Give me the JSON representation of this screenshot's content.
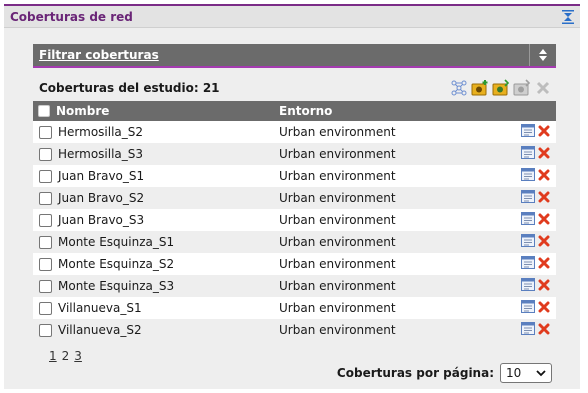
{
  "panel": {
    "title": "Coberturas de red"
  },
  "filter": {
    "label": "Filtrar coberturas"
  },
  "study": {
    "count_label": "Coberturas del estudio: 21"
  },
  "table": {
    "headers": {
      "name": "Nombre",
      "environment": "Entorno"
    },
    "rows": [
      {
        "name": "Hermosilla_S2",
        "environment": "Urban environment"
      },
      {
        "name": "Hermosilla_S3",
        "environment": "Urban environment"
      },
      {
        "name": "Juan Bravo_S1",
        "environment": "Urban environment"
      },
      {
        "name": "Juan Bravo_S2",
        "environment": "Urban environment"
      },
      {
        "name": "Juan Bravo_S3",
        "environment": "Urban environment"
      },
      {
        "name": "Monte Esquinza_S1",
        "environment": "Urban environment"
      },
      {
        "name": "Monte Esquinza_S2",
        "environment": "Urban environment"
      },
      {
        "name": "Monte Esquinza_S3",
        "environment": "Urban environment"
      },
      {
        "name": "Villanueva_S1",
        "environment": "Urban environment"
      },
      {
        "name": "Villanueva_S2",
        "environment": "Urban environment"
      }
    ]
  },
  "pagination": {
    "pages": [
      "1",
      "2",
      "3"
    ],
    "current": "2"
  },
  "per_page": {
    "label": "Coberturas por página:",
    "value": "10"
  },
  "icons": {
    "collapse": "collapse-icon",
    "filter_toggle": "sort-arrows-icon",
    "toolbar": [
      "network-icon",
      "add-coverage-icon",
      "import-coverage-icon",
      "export-coverage-icon",
      "delete-coverage-icon"
    ],
    "row_actions": [
      "edit-icon",
      "delete-icon"
    ]
  },
  "colors": {
    "accent": "#7b2c87",
    "header_bg": "#6b6b6b",
    "delete": "#e03b1e"
  }
}
